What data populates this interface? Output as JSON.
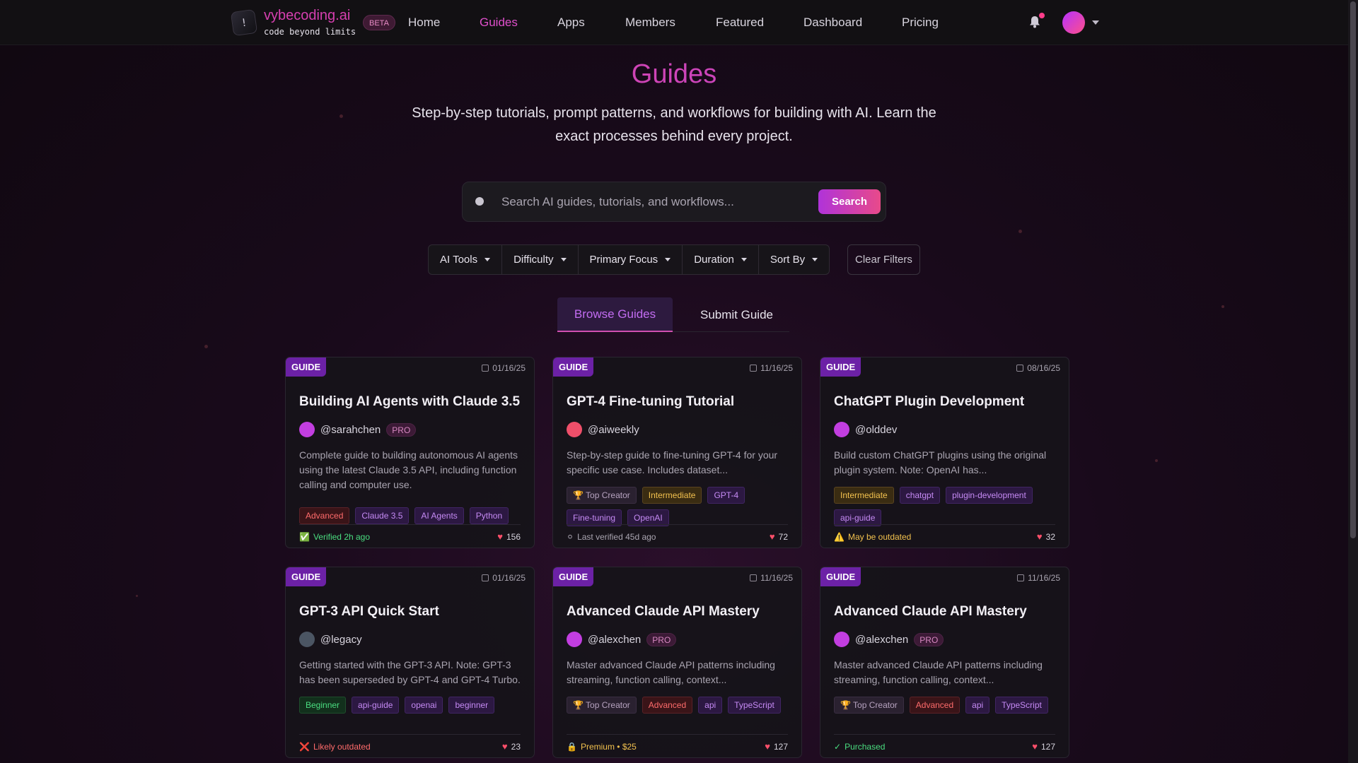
{
  "header": {
    "brand_name": "vybecoding.ai",
    "brand_tagline": "code beyond limits",
    "beta_label": "BETA",
    "nav": [
      {
        "label": "Home",
        "active": false
      },
      {
        "label": "Guides",
        "active": true
      },
      {
        "label": "Apps",
        "active": false
      },
      {
        "label": "Members",
        "active": false
      },
      {
        "label": "Featured",
        "active": false
      },
      {
        "label": "Dashboard",
        "active": false
      },
      {
        "label": "Pricing",
        "active": false
      }
    ]
  },
  "hero": {
    "title": "Guides",
    "subtitle": "Step-by-step tutorials, prompt patterns, and workflows for building with AI. Learn the exact processes behind every project."
  },
  "search": {
    "placeholder": "Search AI guides, tutorials, and workflows...",
    "value": "",
    "button_label": "Search"
  },
  "filters": {
    "dropdowns": [
      "AI Tools",
      "Difficulty",
      "Primary Focus",
      "Duration",
      "Sort By"
    ],
    "clear_label": "Clear Filters"
  },
  "tabs": {
    "browse": "Browse Guides",
    "submit": "Submit Guide"
  },
  "cards": [
    {
      "badge": "GUIDE",
      "date": "01/16/25",
      "title": "Building AI Agents with Claude 3.5",
      "author": "@sarahchen",
      "pro": "PRO",
      "avatar_color": "#c23ee0",
      "description": "Complete guide to building autonomous AI agents using the latest Claude 3.5 API, including function calling and computer use.",
      "tags": [
        {
          "label": "Advanced",
          "kind": "adv"
        },
        {
          "label": "Claude 3.5",
          "kind": "tech"
        },
        {
          "label": "AI Agents",
          "kind": "tech"
        },
        {
          "label": "Python",
          "kind": "tech"
        }
      ],
      "status_icon": "✅",
      "status": "Verified 2h ago",
      "status_color": "#4ade80",
      "likes": "156"
    },
    {
      "badge": "GUIDE",
      "date": "11/16/25",
      "title": "GPT-4 Fine-tuning Tutorial",
      "author": "@aiweekly",
      "pro": "",
      "avatar_color": "#ef4f6a",
      "description": "Step-by-step guide to fine-tuning GPT-4 for your specific use case. Includes dataset...",
      "tags": [
        {
          "label": "🏆 Top Creator",
          "kind": "top"
        },
        {
          "label": "Intermediate",
          "kind": "int"
        },
        {
          "label": "GPT-4",
          "kind": "tech"
        },
        {
          "label": "Fine-tuning",
          "kind": "tech"
        },
        {
          "label": "OpenAI",
          "kind": "tech"
        }
      ],
      "status_icon": "⚪",
      "status": "Last verified 45d ago",
      "status_color": "#a9a4b0",
      "likes": "72"
    },
    {
      "badge": "GUIDE",
      "date": "08/16/25",
      "title": "ChatGPT Plugin Development",
      "author": "@olddev",
      "pro": "",
      "avatar_color": "#c23ee0",
      "description": "Build custom ChatGPT plugins using the original plugin system. Note: OpenAI has...",
      "tags": [
        {
          "label": "Intermediate",
          "kind": "int"
        },
        {
          "label": "chatgpt",
          "kind": "tech"
        },
        {
          "label": "plugin-development",
          "kind": "tech"
        },
        {
          "label": "api-guide",
          "kind": "tech"
        }
      ],
      "status_icon": "⚠️",
      "status": "May be outdated",
      "status_color": "#f2c14e",
      "likes": "32"
    },
    {
      "badge": "GUIDE",
      "date": "01/16/25",
      "title": "GPT-3 API Quick Start",
      "author": "@legacy",
      "pro": "",
      "avatar_color": "#4b5563",
      "description": "Getting started with the GPT-3 API. Note: GPT-3 has been superseded by GPT-4 and GPT-4 Turbo.",
      "tags": [
        {
          "label": "Beginner",
          "kind": "beg"
        },
        {
          "label": "api-guide",
          "kind": "tech"
        },
        {
          "label": "openai",
          "kind": "tech"
        },
        {
          "label": "beginner",
          "kind": "tech"
        }
      ],
      "status_icon": "❌",
      "status": "Likely outdated",
      "status_color": "#ff6b6b",
      "likes": "23"
    },
    {
      "badge": "GUIDE",
      "date": "11/16/25",
      "title": "Advanced Claude API Mastery",
      "author": "@alexchen",
      "pro": "PRO",
      "avatar_color": "#c23ee0",
      "description": "Master advanced Claude API patterns including streaming, function calling, context...",
      "tags": [
        {
          "label": "🏆 Top Creator",
          "kind": "top"
        },
        {
          "label": "Advanced",
          "kind": "adv"
        },
        {
          "label": "api",
          "kind": "tech"
        },
        {
          "label": "TypeScript",
          "kind": "tech"
        }
      ],
      "status_icon": "🔒",
      "status": "Premium • $25",
      "status_color": "#f2c14e",
      "likes": "127"
    },
    {
      "badge": "GUIDE",
      "date": "11/16/25",
      "title": "Advanced Claude API Mastery",
      "author": "@alexchen",
      "pro": "PRO",
      "avatar_color": "#c23ee0",
      "description": "Master advanced Claude API patterns including streaming, function calling, context...",
      "tags": [
        {
          "label": "🏆 Top Creator",
          "kind": "top"
        },
        {
          "label": "Advanced",
          "kind": "adv"
        },
        {
          "label": "api",
          "kind": "tech"
        },
        {
          "label": "TypeScript",
          "kind": "tech"
        }
      ],
      "status_icon": "✓",
      "status": "Purchased",
      "status_color": "#4ade80",
      "likes": "127"
    }
  ],
  "colors": {
    "accent": "#df4fcb",
    "badge": "#6c21a6",
    "background": "#190a1b"
  }
}
